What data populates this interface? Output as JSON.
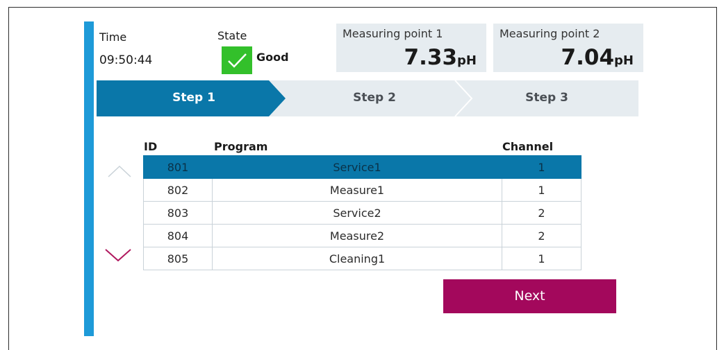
{
  "header": {
    "time_label": "Time",
    "time_value": "09:50:44",
    "state_label": "State",
    "state_value": "Good",
    "state_icon": "check-icon",
    "state_color": "#33c02b"
  },
  "measuring_points": [
    {
      "title": "Measuring point 1",
      "value": "7.33",
      "unit": "pH"
    },
    {
      "title": "Measuring point 2",
      "value": "7.04",
      "unit": "pH"
    }
  ],
  "steps": [
    {
      "label": "Step 1",
      "active": true
    },
    {
      "label": "Step 2",
      "active": false
    },
    {
      "label": "Step 3",
      "active": false
    }
  ],
  "table": {
    "headers": {
      "id": "ID",
      "program": "Program",
      "channel": "Channel"
    },
    "rows": [
      {
        "id": "801",
        "program": "Service1",
        "channel": "1",
        "selected": true
      },
      {
        "id": "802",
        "program": "Measure1",
        "channel": "1",
        "selected": false
      },
      {
        "id": "803",
        "program": "Service2",
        "channel": "2",
        "selected": false
      },
      {
        "id": "804",
        "program": "Measure2",
        "channel": "2",
        "selected": false
      },
      {
        "id": "805",
        "program": "Cleaning1",
        "channel": "1",
        "selected": false
      }
    ]
  },
  "scroll": {
    "up_icon": "chevron-up-icon",
    "down_icon": "chevron-down-icon"
  },
  "actions": {
    "next_label": "Next"
  },
  "colors": {
    "accent_blue": "#1e9ad8",
    "step_active": "#0a77a9",
    "step_inactive": "#e6ecf0",
    "selected_row": "#0a77a9",
    "next_button": "#a3085c",
    "chevron_down": "#b0185e",
    "chevron_up": "#c9d2d8"
  }
}
